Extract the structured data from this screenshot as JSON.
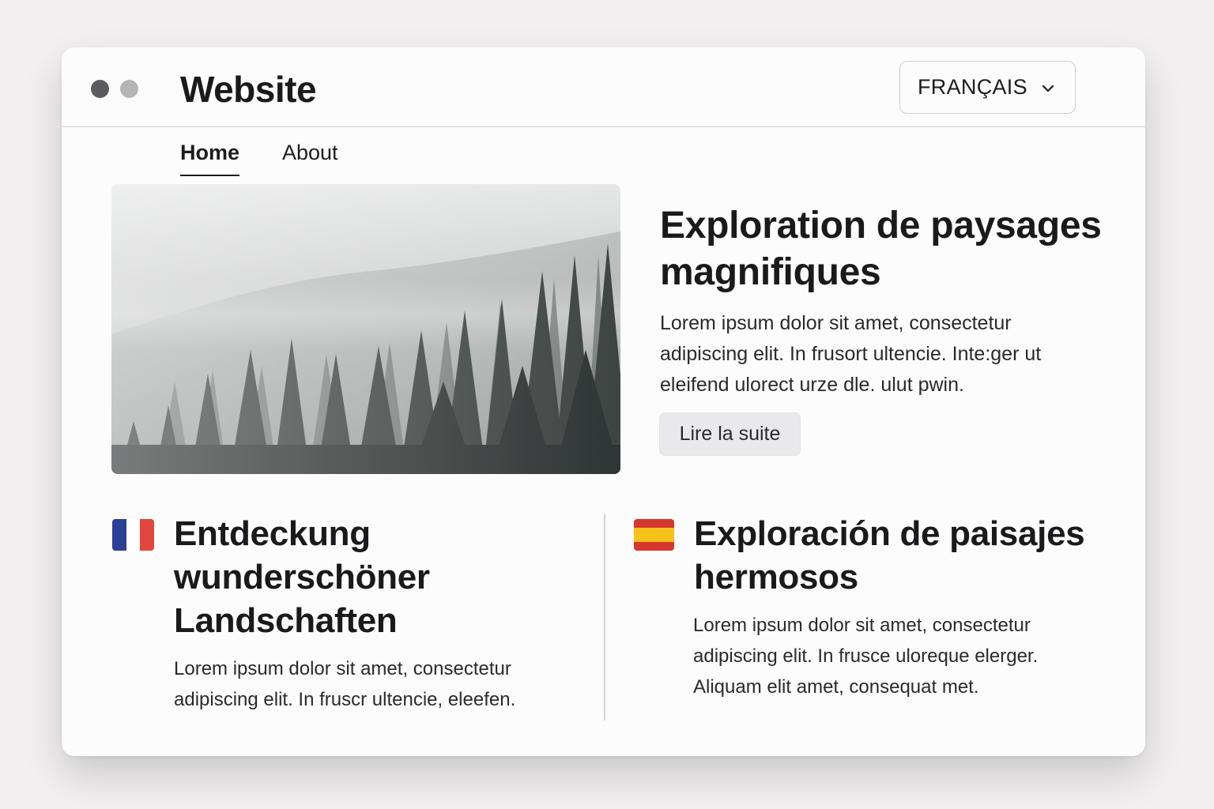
{
  "window": {
    "controls": [
      "close-dot",
      "minimize-dot"
    ]
  },
  "header": {
    "title": "Website",
    "language_select": {
      "selected": "FRANÇAIS",
      "icon": "chevron-down-icon"
    }
  },
  "nav": {
    "items": [
      {
        "label": "Home",
        "active": true
      },
      {
        "label": "About",
        "active": false
      }
    ]
  },
  "hero": {
    "image": "misty-forest-image",
    "title": "Exploration de paysages magnifiques",
    "body": "Lorem ipsum dolor sit amet, consectetur adipiscing elit. In frusort ultencie. Inte:ger ut eleifend ulorect urze dle. ulut pwin.",
    "button_label": "Lire la suite"
  },
  "cards": [
    {
      "flag": "flag-fr-icon",
      "title": "Entdeckung wunderschöner Landschaften",
      "body": "Lorem ipsum dolor sit amet, consectetur adipiscing elit. In fruscr ultencie, eleefen."
    },
    {
      "flag": "flag-es-icon",
      "title": "Exploración de paisajes hermosos",
      "body": "Lorem ipsum dolor sit amet, consectetur adipiscing elit. In frusce uloreque elerger. Aliquam elit amet, consequat met."
    }
  ],
  "colors": {
    "page_bg": "#f1eff0",
    "window_bg": "#fdfcfd",
    "text": "#1c1c1e",
    "button_bg": "#e9e8ea",
    "flag_fr": [
      "#2b3f95",
      "#ffffff",
      "#e2453c"
    ],
    "flag_es": [
      "#d5372e",
      "#f4c21a",
      "#d5372e"
    ]
  }
}
